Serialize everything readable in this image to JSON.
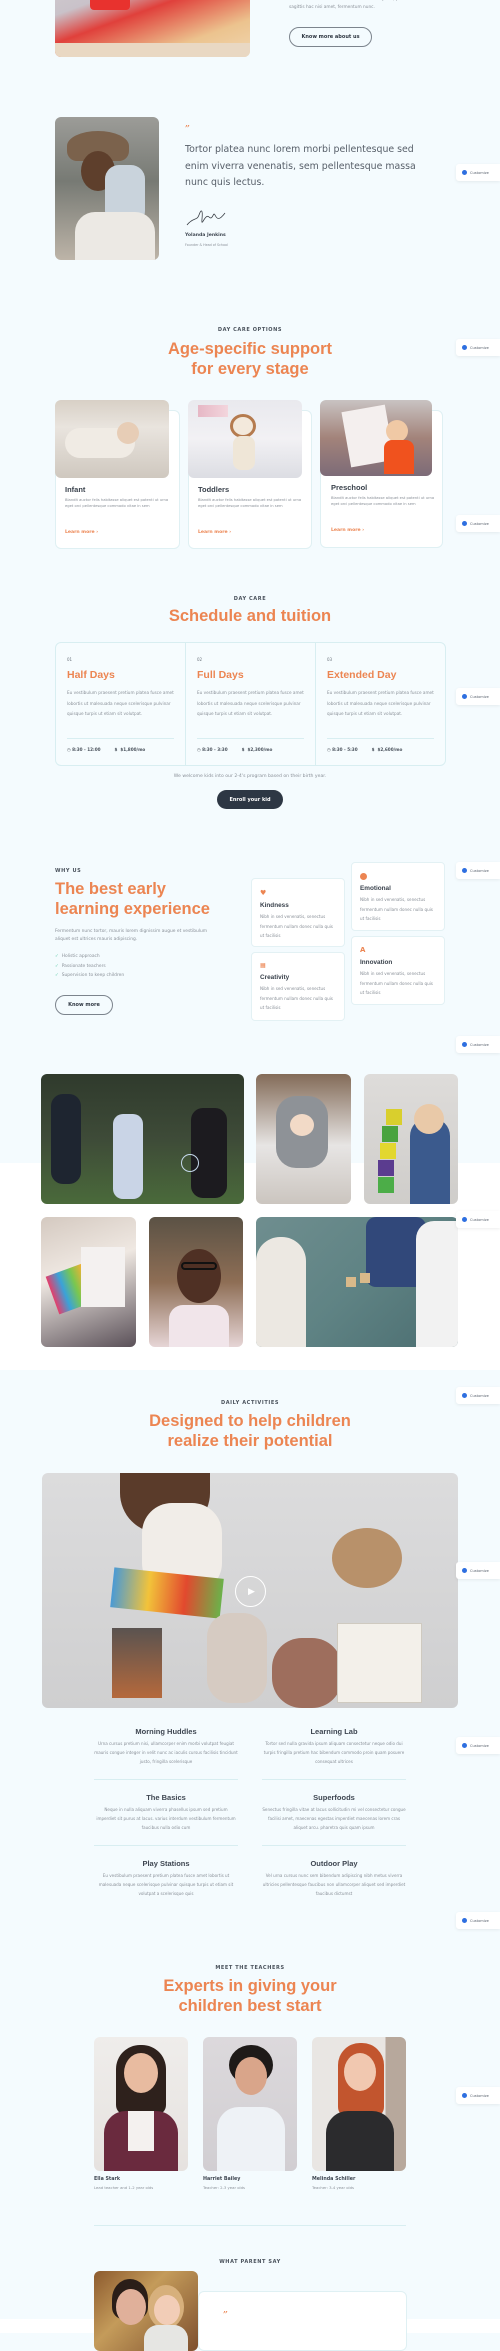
{
  "about": {
    "text_line1": "sodales sed non vel malesuada morbi arcu justo, pretium",
    "text_line2": "sagittis hac nisi amet, fermentum nunc.",
    "button_label": "Know more about us"
  },
  "customize_label": "Customize",
  "founder_quote": {
    "quote_mark": "”",
    "text": "Tortor platea nunc lorem morbi pellentesque sed enim viverra venenatis, sem pellentesque massa nunc quis lectus.",
    "signature": "Yolanda Jenkins signature",
    "name": "Yolanda Jenkins",
    "role": "Founder & Head of School"
  },
  "day_care_options": {
    "eyebrow": "DAY CARE OPTIONS",
    "title_line1": "Age-specific support",
    "title_line2": "for every stage",
    "cards": [
      {
        "title": "Infant",
        "desc": "Blandit auctor felis habitasse aliquet est potenti ut urna eget orci pellentesque commodo vitae in sem",
        "link": "Learn more"
      },
      {
        "title": "Toddlers",
        "desc": "Blandit auctor felis habitasse aliquet est potenti ut urna eget orci pellentesque commodo vitae in sem",
        "link": "Learn more"
      },
      {
        "title": "Preschool",
        "desc": "Blandit auctor felis habitasse aliquet est potenti ut urna eget orci pellentesque commodo vitae in sem",
        "link": "Learn more"
      }
    ]
  },
  "schedule": {
    "eyebrow": "DAY CARE",
    "title": "Schedule and tuition",
    "plans": [
      {
        "num": "01",
        "title": "Half Days",
        "desc": "Eu vestibulum praesent pretium platea fusce amet lobortis ut malesuada neque scelerisque pulvinar quisque turpis ut etiam sit volutpat.",
        "hours": "8:30 - 12:00",
        "price": "$1,800/mo"
      },
      {
        "num": "02",
        "title": "Full Days",
        "desc": "Eu vestibulum praesent pretium platea fusce amet lobortis ut malesuada neque scelerisque pulvinar quisque turpis ut etiam sit volutpat.",
        "hours": "8:30 - 3:30",
        "price": "$2,300/mo"
      },
      {
        "num": "03",
        "title": "Extended Day",
        "desc": "Eu vestibulum praesent pretium platea fusce amet lobortis ut malesuada neque scelerisque pulvinar quisque turpis ut etiam sit volutpat.",
        "hours": "8:30 - 5:30",
        "price": "$2,600/mo"
      }
    ],
    "note": "We welcome kids into our 2-4's program based on their birth year.",
    "enroll_label": "Enroll your kid"
  },
  "why_us": {
    "eyebrow": "WHY US",
    "title_line1": "The best early",
    "title_line2": "learning experience",
    "desc": "Fermentum nunc tortor, mauris lorem dignissim augue et vestibulum aliquet est ultrices mauris adipiscing.",
    "checklist": [
      "Holistic approach",
      "Passionate teachers",
      "Supervision to keep children"
    ],
    "button_label": "Know more",
    "features": [
      {
        "title": "Kindness",
        "desc": "Nibh in sed venenatis, senectus fermentum nullam donec nulla quis ut facilisis",
        "icon": "heart"
      },
      {
        "title": "Emotional",
        "desc": "Nibh in sed venenatis, senectus fermentum nullam donec nulla quis ut facilisis",
        "icon": "smile"
      },
      {
        "title": "Creativity",
        "desc": "Nibh in sed venenatis, senectus fermentum nullam donec nulla quis ut facilisis",
        "icon": "shapes"
      },
      {
        "title": "Innovation",
        "desc": "Nibh in sed venenatis, senectus fermentum nullam donec nulla quis ut facilisis",
        "icon": "compass"
      }
    ]
  },
  "gallery": {
    "photos": [
      "Children playing with bubbles",
      "Baby in grey snowsuit",
      "Toddler stacking blocks",
      "Child coloring with markers",
      "Smiling girl with glasses",
      "Kids playing with letter blocks"
    ]
  },
  "daily_activities": {
    "eyebrow": "DAILY ACTIVITIES",
    "title_line1": "Designed to help children",
    "title_line2": "realize their potential",
    "video_label": "Play video",
    "items": [
      {
        "title": "Morning Huddles",
        "desc": "Urna cursus pretium nisi, ullamcorper enim morbi volutpat feugiat mauris congue integer in velit nunc ac iaculis cursus facilisis tincidunt justo, fringilla scelerisque"
      },
      {
        "title": "Learning Lab",
        "desc": "Tortor sed nulla gravida ipsum aliquam consectetur neque odio dui turpis fringilla pretium hac bibendum commodo proin quam posuere consequat ultrices"
      },
      {
        "title": "The Basics",
        "desc": "Neque in nulla aliquam viverra phasellus ipsum sed pretium imperdiet sit purus at lacus. varius interdum vestibulum fermentum faucibus nulla odio cum"
      },
      {
        "title": "Superfoods",
        "desc": "Senectus fringilla vitae at lacus sollicitudin mi vel consectetur congue facilisi amet, maecenas egestas imperdiet maecenas lorem cras aliquet arcu. pharetra quis quam ipsum"
      },
      {
        "title": "Play Stations",
        "desc": "Eu vestibulum praesent pretium platea fusce amet lobortis ut malesuada neque scelerisque pulvinar quisque turpis ut etiam sit volutpat a scelerisque quis"
      },
      {
        "title": "Outdoor Play",
        "desc": "Vel urna cursus nunc sem bibendum adipiscing nibh metus viverra ultricies pellentesque faucibus non ullamcorper aliquet sed imperdiet faucibus dictumst"
      }
    ]
  },
  "teachers": {
    "eyebrow": "MEET THE TEACHERS",
    "title_line1": "Experts in giving your",
    "title_line2": "children best start",
    "people": [
      {
        "name": "Ella Stark",
        "role": "Lead teacher and 1-2 year olds"
      },
      {
        "name": "Harriet Bailey",
        "role": "Teacher: 2-3 year olds"
      },
      {
        "name": "Melinda Schiller",
        "role": "Teacher: 3-4 year olds"
      }
    ]
  },
  "testimonials": {
    "eyebrow": "WHAT PARENT SAY",
    "quote_mark": "”"
  }
}
